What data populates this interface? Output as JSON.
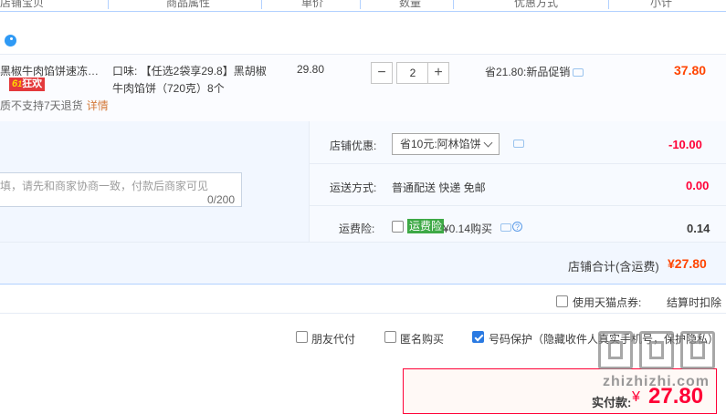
{
  "header": {
    "cols": [
      "店铺宝贝",
      "商品属性",
      "单价",
      "数量",
      "优惠方式",
      "小计"
    ]
  },
  "item": {
    "title": "黑椒牛肉馅饼速冻半成品",
    "badge_num": "6",
    "badge_text": "狂欢",
    "no_return": "质不支持7天退货",
    "details_link": "详情",
    "attr": "口味: 【任选2袋享29.8】黑胡椒牛肉馅饼（720克）8个",
    "price": "29.80",
    "quantity": "2",
    "minus": "−",
    "plus": "+",
    "promo": "省21.80:新品促销",
    "subtotal": "37.80"
  },
  "shop_options": {
    "memo_placeholder": "填，请先和商家协商一致，付款后商家可见",
    "memo_count": "0/200",
    "coupon_label": "店铺优惠:",
    "coupon_selected": "省10元:阿林馅饼",
    "coupon_value": "-10.00",
    "shipping_label": "运送方式:",
    "shipping_value": "普通配送 快递 免邮",
    "shipping_fee": "0.00",
    "insurance_label": "运费险:",
    "insurance_tag": "运费险",
    "insurance_text": "¥0.14购买",
    "insurance_value": "0.14",
    "help": "?"
  },
  "shop_total": {
    "label": "店铺合计(含运费)",
    "value": "¥27.80"
  },
  "points": {
    "label": "使用天猫点券:",
    "note": "结算时扣除"
  },
  "bottom_options": {
    "friend_pay": "朋友代付",
    "anonymous": "匿名购买",
    "number_protect": "号码保护（隐藏收件人真实手机号，保护隐私）"
  },
  "pay": {
    "label": "实付款:",
    "currency": "¥",
    "value": "27.80"
  },
  "watermark": "zhizhizhi.com",
  "colors": {
    "accent_red": "#ff0036",
    "price_orange": "#ff4400",
    "panel_blue": "#f2f7ff",
    "checkbox_blue": "#2a7ae2",
    "insurance_green": "#3ea946"
  }
}
